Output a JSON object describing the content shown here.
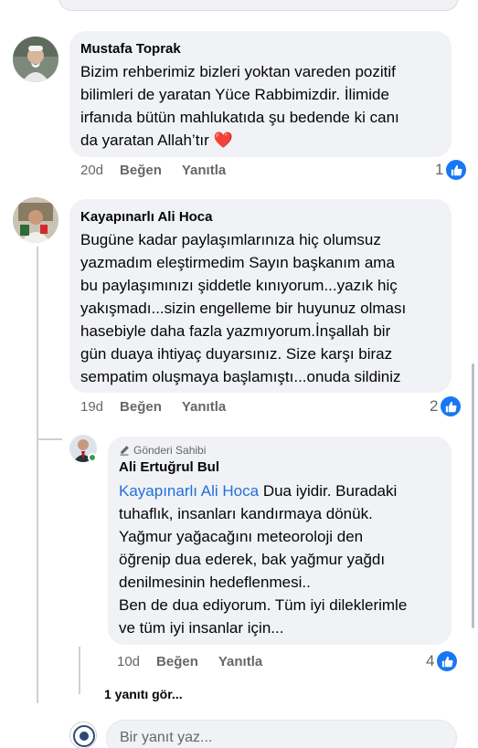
{
  "comments": [
    {
      "author": "Mustafa Toprak",
      "text": "Bizim rehberimiz bizleri yoktan vareden pozitif\nbilimleri de yaratan Yüce Rabbimizdir. İlimide\nirfanıda bütün mahlukatıda şu bedende ki canı\nda yaratan Allah’tır",
      "emoji": "❤️",
      "age": "20d",
      "like_label": "Beğen",
      "reply_label": "Yanıtla",
      "reaction_count": "1"
    },
    {
      "author": "Kayapınarlı Ali Hoca",
      "text": "Bugüne kadar paylaşımlarınıza hiç olumsuz\nyazmadım eleştirmedim Sayın başkanım ama\nbu paylaşımınızı şiddetle kınıyorum...yazık hiç\nyakışmadı...sizin engelleme bir huyunuz olması\nhasebiyle daha fazla yazmıyorum.İnşallah bir\ngün duaya ihtiyaç duyarsınız. Size karşı biraz\nsempatim oluşmaya başlamıştı...onuda sildiniz",
      "age": "19d",
      "like_label": "Beğen",
      "reply_label": "Yanıtla",
      "reaction_count": "2"
    }
  ],
  "reply": {
    "badge": "Gönderi Sahibi",
    "author": "Ali Ertuğrul Bul",
    "mention": "Kayapınarlı Ali Hoca",
    "text_first": " Dua iyidir. Buradaki",
    "text_rest": "tuhaflık, insanları kandırmaya dönük.\nYağmur yağacağını meteoroloji den\nöğrenip dua ederek, bak yağmur yağdı\ndenilmesinin hedeflenmesi..\nBen de dua ediyorum. Tüm iyi dileklerimle\nve tüm iyi insanlar için...",
    "age": "10d",
    "like_label": "Beğen",
    "reply_label": "Yanıtla",
    "reaction_count": "4"
  },
  "see_replies": "1 yanıtı gör...",
  "reply_input_placeholder": "Bir yanıt yaz...",
  "colors": {
    "like_blue": "#1877f2",
    "mention_blue": "#216fdb",
    "heart_red": "#e41e3f",
    "online_green": "#31a24c"
  },
  "icons": [
    "like-thumb-icon",
    "heart-emoji",
    "pencil-icon",
    "user-avatar"
  ]
}
